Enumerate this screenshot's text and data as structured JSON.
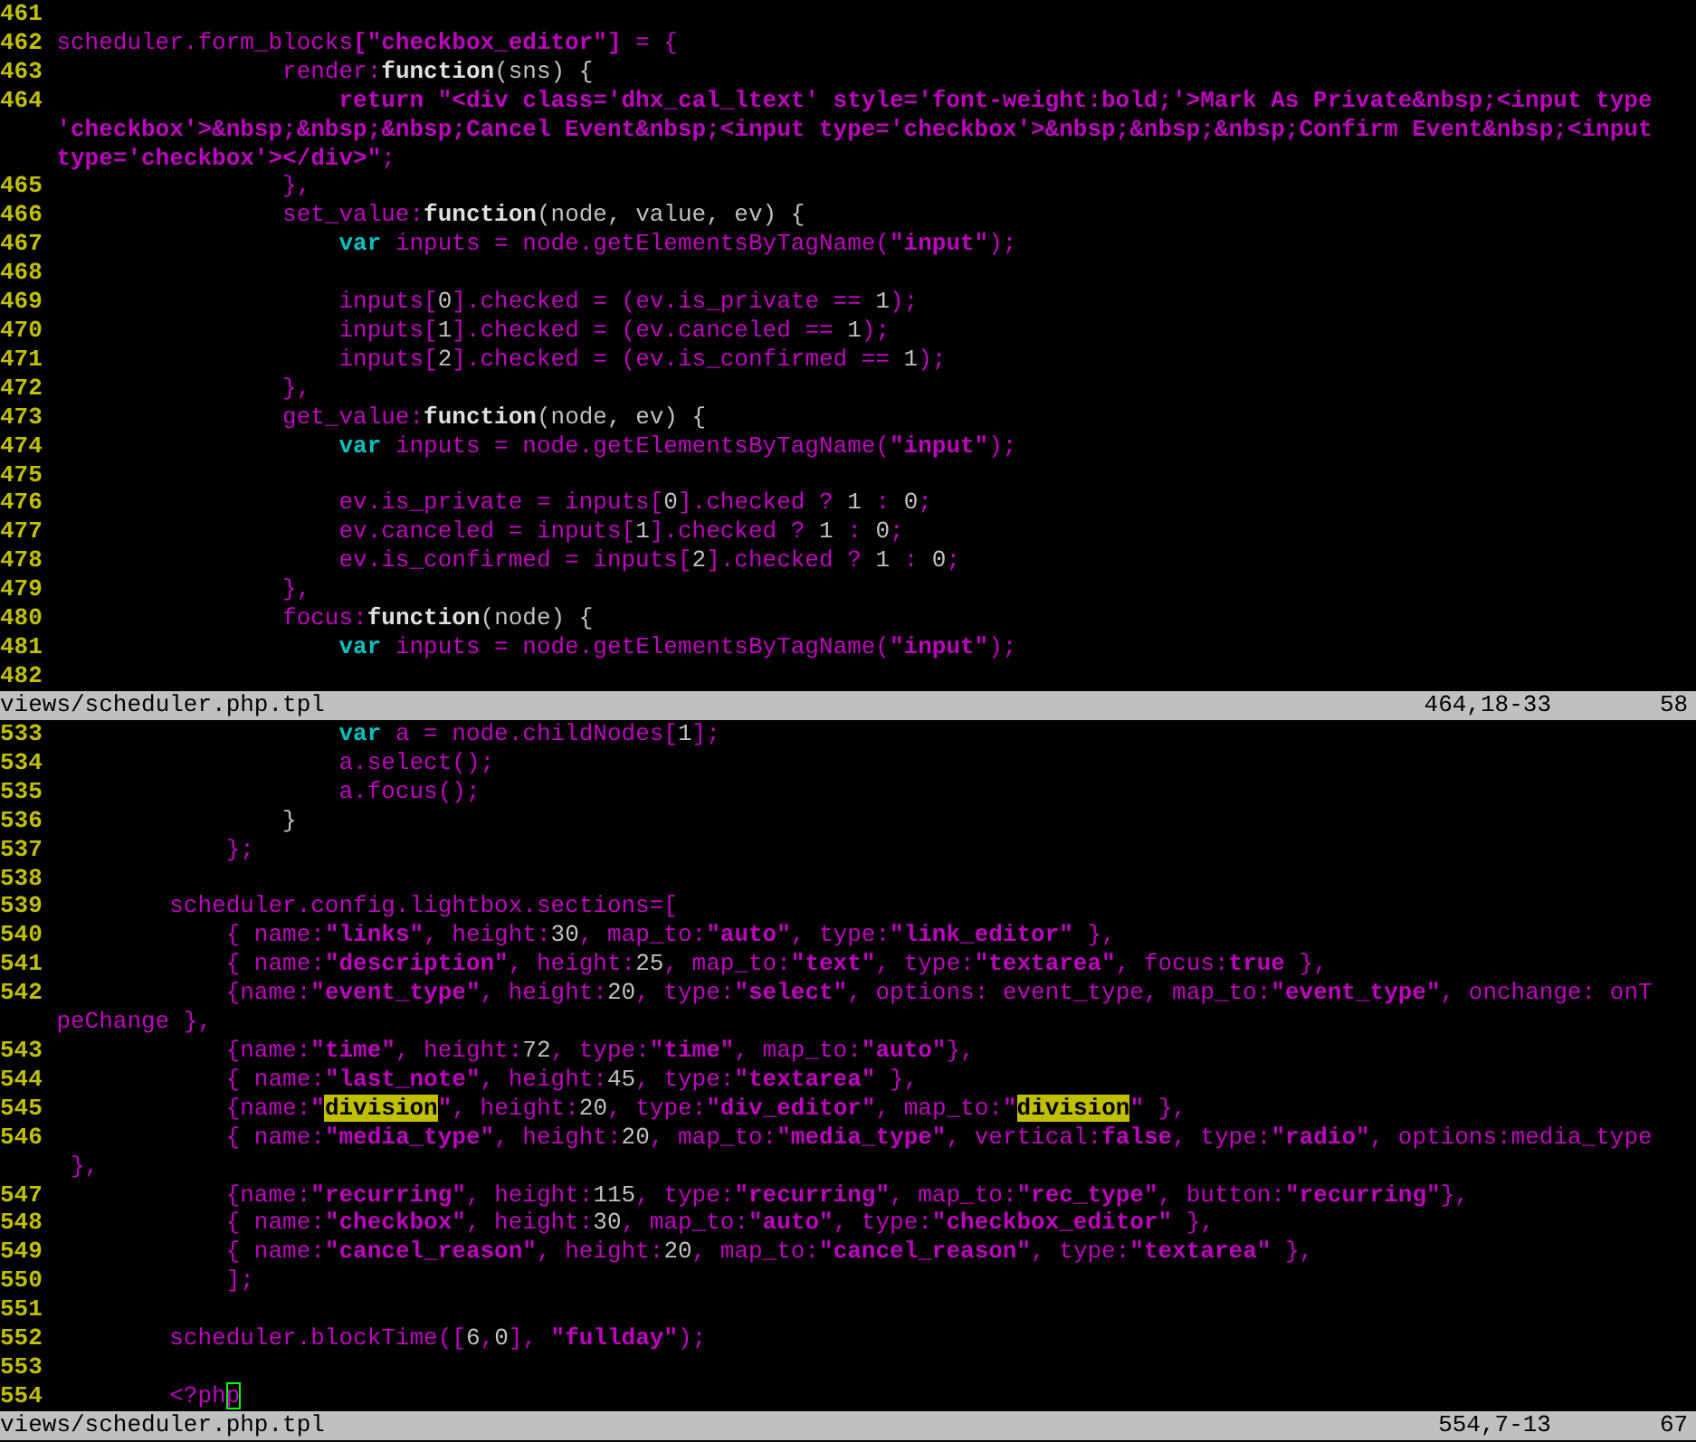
{
  "panes": [
    {
      "lines": [
        {
          "number": "461"
        },
        {
          "number": "462",
          "segments": [
            {
              "kind": "ident",
              "text": "scheduler.form_blocks"
            },
            {
              "kind": "string",
              "text": "[\"checkbox_editor\"]"
            },
            {
              "kind": "ident",
              "text": " = {"
            }
          ]
        },
        {
          "number": "463",
          "segments": [
            {
              "kind": "ident",
              "text": "                render:"
            },
            {
              "kind": "keyword",
              "text": "function"
            },
            {
              "kind": "number",
              "text": "(sns) {"
            }
          ]
        },
        {
          "number": "464",
          "segments": [
            {
              "kind": "string",
              "text": "                    return \"<div class='dhx_cal_ltext' style='font-weight:bold;'>Mark As Private&nbsp;<input type"
            },
            {
              "kind": "wrap"
            },
            {
              "kind": "string",
              "text": "'checkbox'>&nbsp;&nbsp;&nbsp;Cancel Event&nbsp;<input type='checkbox'>&nbsp;&nbsp;&nbsp;Confirm Event&nbsp;<input"
            },
            {
              "kind": "wrap"
            },
            {
              "kind": "string",
              "text": "type='checkbox'></div>\""
            },
            {
              "kind": "ident",
              "text": ";"
            }
          ]
        },
        {
          "number": "465",
          "segments": [
            {
              "kind": "ident",
              "text": "                },"
            }
          ]
        },
        {
          "number": "466",
          "segments": [
            {
              "kind": "ident",
              "text": "                set_value:"
            },
            {
              "kind": "keyword",
              "text": "function"
            },
            {
              "kind": "number",
              "text": "(node, value, ev) {"
            }
          ]
        },
        {
          "number": "467",
          "segments": [
            {
              "kind": "type",
              "text": "                    var"
            },
            {
              "kind": "ident",
              "text": " inputs = node.getElementsByTagName("
            },
            {
              "kind": "string",
              "text": "\"input\""
            },
            {
              "kind": "ident",
              "text": ");"
            }
          ]
        },
        {
          "number": "468"
        },
        {
          "number": "469",
          "segments": [
            {
              "kind": "ident",
              "text": "                    inputs["
            },
            {
              "kind": "number",
              "text": "0"
            },
            {
              "kind": "ident",
              "text": "].checked = (ev.is_private == "
            },
            {
              "kind": "number",
              "text": "1"
            },
            {
              "kind": "ident",
              "text": ");"
            }
          ]
        },
        {
          "number": "470",
          "segments": [
            {
              "kind": "ident",
              "text": "                    inputs["
            },
            {
              "kind": "number",
              "text": "1"
            },
            {
              "kind": "ident",
              "text": "].checked = (ev.canceled == "
            },
            {
              "kind": "number",
              "text": "1"
            },
            {
              "kind": "ident",
              "text": ");"
            }
          ]
        },
        {
          "number": "471",
          "segments": [
            {
              "kind": "ident",
              "text": "                    inputs["
            },
            {
              "kind": "number",
              "text": "2"
            },
            {
              "kind": "ident",
              "text": "].checked = (ev.is_confirmed == "
            },
            {
              "kind": "number",
              "text": "1"
            },
            {
              "kind": "ident",
              "text": ");"
            }
          ]
        },
        {
          "number": "472",
          "segments": [
            {
              "kind": "ident",
              "text": "                },"
            }
          ]
        },
        {
          "number": "473",
          "segments": [
            {
              "kind": "ident",
              "text": "                get_value:"
            },
            {
              "kind": "keyword",
              "text": "function"
            },
            {
              "kind": "number",
              "text": "(node, ev) {"
            }
          ]
        },
        {
          "number": "474",
          "segments": [
            {
              "kind": "type",
              "text": "                    var"
            },
            {
              "kind": "ident",
              "text": " inputs = node.getElementsByTagName("
            },
            {
              "kind": "string",
              "text": "\"input\""
            },
            {
              "kind": "ident",
              "text": ");"
            }
          ]
        },
        {
          "number": "475"
        },
        {
          "number": "476",
          "segments": [
            {
              "kind": "ident",
              "text": "                    ev.is_private = inputs["
            },
            {
              "kind": "number",
              "text": "0"
            },
            {
              "kind": "ident",
              "text": "].checked ? "
            },
            {
              "kind": "number",
              "text": "1"
            },
            {
              "kind": "ident",
              "text": " : "
            },
            {
              "kind": "number",
              "text": "0"
            },
            {
              "kind": "ident",
              "text": ";"
            }
          ]
        },
        {
          "number": "477",
          "segments": [
            {
              "kind": "ident",
              "text": "                    ev.canceled = inputs["
            },
            {
              "kind": "number",
              "text": "1"
            },
            {
              "kind": "ident",
              "text": "].checked ? "
            },
            {
              "kind": "number",
              "text": "1"
            },
            {
              "kind": "ident",
              "text": " : "
            },
            {
              "kind": "number",
              "text": "0"
            },
            {
              "kind": "ident",
              "text": ";"
            }
          ]
        },
        {
          "number": "478",
          "segments": [
            {
              "kind": "ident",
              "text": "                    ev.is_confirmed = inputs["
            },
            {
              "kind": "number",
              "text": "2"
            },
            {
              "kind": "ident",
              "text": "].checked ? "
            },
            {
              "kind": "number",
              "text": "1"
            },
            {
              "kind": "ident",
              "text": " : "
            },
            {
              "kind": "number",
              "text": "0"
            },
            {
              "kind": "ident",
              "text": ";"
            }
          ]
        },
        {
          "number": "479",
          "segments": [
            {
              "kind": "ident",
              "text": "                },"
            }
          ]
        },
        {
          "number": "480",
          "segments": [
            {
              "kind": "ident",
              "text": "                focus:"
            },
            {
              "kind": "keyword",
              "text": "function"
            },
            {
              "kind": "number",
              "text": "(node) {"
            }
          ]
        },
        {
          "number": "481",
          "segments": [
            {
              "kind": "type",
              "text": "                    var"
            },
            {
              "kind": "ident",
              "text": " inputs = node.getElementsByTagName("
            },
            {
              "kind": "string",
              "text": "\"input\""
            },
            {
              "kind": "ident",
              "text": ");"
            }
          ]
        },
        {
          "number": "482"
        }
      ],
      "status": {
        "file": "views/scheduler.php.tpl",
        "position": "464,18-33",
        "percent": "58"
      }
    },
    {
      "lines": [
        {
          "number": "533",
          "segments": [
            {
              "kind": "type",
              "text": "                    var"
            },
            {
              "kind": "ident",
              "text": " a = node.childNodes["
            },
            {
              "kind": "number",
              "text": "1"
            },
            {
              "kind": "ident",
              "text": "];"
            }
          ]
        },
        {
          "number": "534",
          "segments": [
            {
              "kind": "ident",
              "text": "                    a.select();"
            }
          ]
        },
        {
          "number": "535",
          "segments": [
            {
              "kind": "ident",
              "text": "                    a.focus();"
            }
          ]
        },
        {
          "number": "536",
          "segments": [
            {
              "kind": "number",
              "text": "                }"
            }
          ]
        },
        {
          "number": "537",
          "segments": [
            {
              "kind": "ident",
              "text": "            };"
            }
          ]
        },
        {
          "number": "538"
        },
        {
          "number": "539",
          "segments": [
            {
              "kind": "ident",
              "text": "        scheduler.config.lightbox.sections=["
            }
          ]
        },
        {
          "number": "540",
          "segments": [
            {
              "kind": "ident",
              "text": "            { name:"
            },
            {
              "kind": "string",
              "text": "\"links\""
            },
            {
              "kind": "ident",
              "text": ", height:"
            },
            {
              "kind": "number",
              "text": "30"
            },
            {
              "kind": "ident",
              "text": ", map_to:"
            },
            {
              "kind": "string",
              "text": "\"auto\""
            },
            {
              "kind": "ident",
              "text": ", type:"
            },
            {
              "kind": "string",
              "text": "\"link_editor\""
            },
            {
              "kind": "ident",
              "text": " },"
            }
          ]
        },
        {
          "number": "541",
          "segments": [
            {
              "kind": "ident",
              "text": "            { name:"
            },
            {
              "kind": "string",
              "text": "\"description\""
            },
            {
              "kind": "ident",
              "text": ", height:"
            },
            {
              "kind": "number",
              "text": "25"
            },
            {
              "kind": "ident",
              "text": ", map_to:"
            },
            {
              "kind": "string",
              "text": "\"text\""
            },
            {
              "kind": "ident",
              "text": ", type:"
            },
            {
              "kind": "string",
              "text": "\"textarea\""
            },
            {
              "kind": "ident",
              "text": ", focus:"
            },
            {
              "kind": "string",
              "text": "true"
            },
            {
              "kind": "ident",
              "text": " },"
            }
          ]
        },
        {
          "number": "542",
          "segments": [
            {
              "kind": "ident",
              "text": "            {name:"
            },
            {
              "kind": "string",
              "text": "\"event_type\""
            },
            {
              "kind": "ident",
              "text": ", height:"
            },
            {
              "kind": "number",
              "text": "20"
            },
            {
              "kind": "ident",
              "text": ", type:"
            },
            {
              "kind": "string",
              "text": "\"select\""
            },
            {
              "kind": "ident",
              "text": ", options: event_type, map_to:"
            },
            {
              "kind": "string",
              "text": "\"event_type\""
            },
            {
              "kind": "ident",
              "text": ", onchange: onT"
            },
            {
              "kind": "wrap"
            },
            {
              "kind": "ident",
              "text": "peChange },"
            }
          ]
        },
        {
          "number": "543",
          "segments": [
            {
              "kind": "ident",
              "text": "            {name:"
            },
            {
              "kind": "string",
              "text": "\"time\""
            },
            {
              "kind": "ident",
              "text": ", height:"
            },
            {
              "kind": "number",
              "text": "72"
            },
            {
              "kind": "ident",
              "text": ", type:"
            },
            {
              "kind": "string",
              "text": "\"time\""
            },
            {
              "kind": "ident",
              "text": ", map_to:"
            },
            {
              "kind": "string",
              "text": "\"auto\""
            },
            {
              "kind": "ident",
              "text": "},"
            }
          ]
        },
        {
          "number": "544",
          "segments": [
            {
              "kind": "ident",
              "text": "            { name:"
            },
            {
              "kind": "string",
              "text": "\"last_note\""
            },
            {
              "kind": "ident",
              "text": ", height:"
            },
            {
              "kind": "number",
              "text": "45"
            },
            {
              "kind": "ident",
              "text": ", type:"
            },
            {
              "kind": "string",
              "text": "\"textarea\""
            },
            {
              "kind": "ident",
              "text": " },"
            }
          ]
        },
        {
          "number": "545",
          "segments": [
            {
              "kind": "ident",
              "text": "            {name:"
            },
            {
              "kind": "string",
              "text": "\""
            },
            {
              "kind": "match",
              "text": "division"
            },
            {
              "kind": "string",
              "text": "\""
            },
            {
              "kind": "ident",
              "text": ", height:"
            },
            {
              "kind": "number",
              "text": "20"
            },
            {
              "kind": "ident",
              "text": ", type:"
            },
            {
              "kind": "string",
              "text": "\"div_editor\""
            },
            {
              "kind": "ident",
              "text": ", map_to:"
            },
            {
              "kind": "string",
              "text": "\""
            },
            {
              "kind": "match",
              "text": "division"
            },
            {
              "kind": "string",
              "text": "\""
            },
            {
              "kind": "ident",
              "text": " },"
            }
          ]
        },
        {
          "number": "546",
          "segments": [
            {
              "kind": "ident",
              "text": "            { name:"
            },
            {
              "kind": "string",
              "text": "\"media_type\""
            },
            {
              "kind": "ident",
              "text": ", height:"
            },
            {
              "kind": "number",
              "text": "20"
            },
            {
              "kind": "ident",
              "text": ", map_to:"
            },
            {
              "kind": "string",
              "text": "\"media_type\""
            },
            {
              "kind": "ident",
              "text": ", vertical:"
            },
            {
              "kind": "string",
              "text": "false"
            },
            {
              "kind": "ident",
              "text": ", type:"
            },
            {
              "kind": "string",
              "text": "\"radio\""
            },
            {
              "kind": "ident",
              "text": ", options:media_type"
            },
            {
              "kind": "wrap"
            },
            {
              "kind": "ident",
              "text": " },"
            }
          ]
        },
        {
          "number": "547",
          "segments": [
            {
              "kind": "ident",
              "text": "            {name:"
            },
            {
              "kind": "string",
              "text": "\"recurring\""
            },
            {
              "kind": "ident",
              "text": ", height:"
            },
            {
              "kind": "number",
              "text": "115"
            },
            {
              "kind": "ident",
              "text": ", type:"
            },
            {
              "kind": "string",
              "text": "\"recurring\""
            },
            {
              "kind": "ident",
              "text": ", map_to:"
            },
            {
              "kind": "string",
              "text": "\"rec_type\""
            },
            {
              "kind": "ident",
              "text": ", button:"
            },
            {
              "kind": "string",
              "text": "\"recurring\""
            },
            {
              "kind": "ident",
              "text": "},"
            }
          ]
        },
        {
          "number": "548",
          "segments": [
            {
              "kind": "ident",
              "text": "            { name:"
            },
            {
              "kind": "string",
              "text": "\"checkbox\""
            },
            {
              "kind": "ident",
              "text": ", height:"
            },
            {
              "kind": "number",
              "text": "30"
            },
            {
              "kind": "ident",
              "text": ", map_to:"
            },
            {
              "kind": "string",
              "text": "\"auto\""
            },
            {
              "kind": "ident",
              "text": ", type:"
            },
            {
              "kind": "string",
              "text": "\"checkbox_editor\""
            },
            {
              "kind": "ident",
              "text": " },"
            }
          ]
        },
        {
          "number": "549",
          "segments": [
            {
              "kind": "ident",
              "text": "            { name:"
            },
            {
              "kind": "string",
              "text": "\"cancel_reason\""
            },
            {
              "kind": "ident",
              "text": ", height:"
            },
            {
              "kind": "number",
              "text": "20"
            },
            {
              "kind": "ident",
              "text": ", map_to:"
            },
            {
              "kind": "string",
              "text": "\"cancel_reason\""
            },
            {
              "kind": "ident",
              "text": ", type:"
            },
            {
              "kind": "string",
              "text": "\"textarea\""
            },
            {
              "kind": "ident",
              "text": " },"
            }
          ]
        },
        {
          "number": "550",
          "segments": [
            {
              "kind": "ident",
              "text": "            ];"
            }
          ]
        },
        {
          "number": "551"
        },
        {
          "number": "552",
          "segments": [
            {
              "kind": "ident",
              "text": "        scheduler.blockTime(["
            },
            {
              "kind": "number",
              "text": "6"
            },
            {
              "kind": "ident",
              "text": ","
            },
            {
              "kind": "number",
              "text": "0"
            },
            {
              "kind": "ident",
              "text": "], "
            },
            {
              "kind": "string",
              "text": "\"fullday\""
            },
            {
              "kind": "ident",
              "text": ");"
            }
          ]
        },
        {
          "number": "553"
        },
        {
          "number": "554",
          "segments": [
            {
              "kind": "ident",
              "text": "        <?ph"
            },
            {
              "kind": "cursor",
              "text": "p"
            }
          ]
        }
      ],
      "status": {
        "file": "views/scheduler.php.tpl",
        "position": "554,7-13",
        "percent": "67"
      }
    }
  ]
}
